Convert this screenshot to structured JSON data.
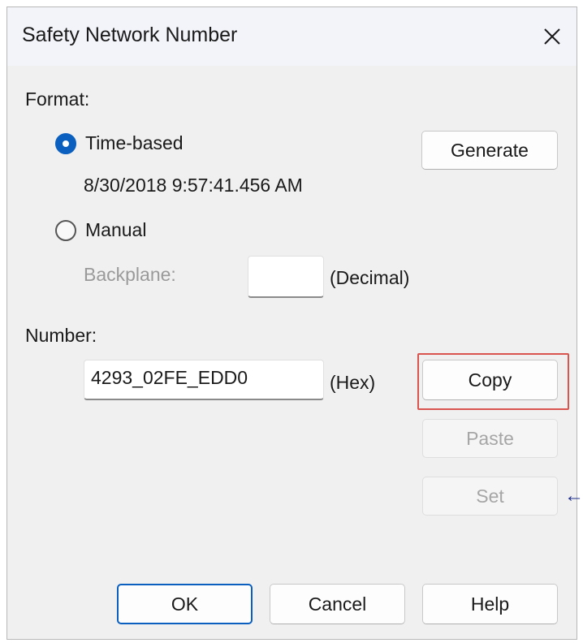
{
  "window": {
    "title": "Safety Network Number",
    "close_icon": "close-icon"
  },
  "format": {
    "label": "Format:",
    "time_based": {
      "label": "Time-based",
      "selected": true,
      "timestamp": "8/30/2018 9:57:41.456 AM"
    },
    "manual": {
      "label": "Manual",
      "selected": false
    },
    "backplane": {
      "label": "Backplane:",
      "value": "",
      "unit": "(Decimal)"
    },
    "generate_label": "Generate"
  },
  "number": {
    "label": "Number:",
    "value": "4293_02FE_EDD0",
    "unit": "(Hex)"
  },
  "actions": {
    "copy_label": "Copy",
    "paste_label": "Paste",
    "set_label": "Set",
    "set_arrow": "←"
  },
  "footer": {
    "ok_label": "OK",
    "cancel_label": "Cancel",
    "help_label": "Help"
  },
  "colors": {
    "accent": "#0a5fbf",
    "highlight": "#d9534f",
    "arrow": "#1f2f8a"
  }
}
